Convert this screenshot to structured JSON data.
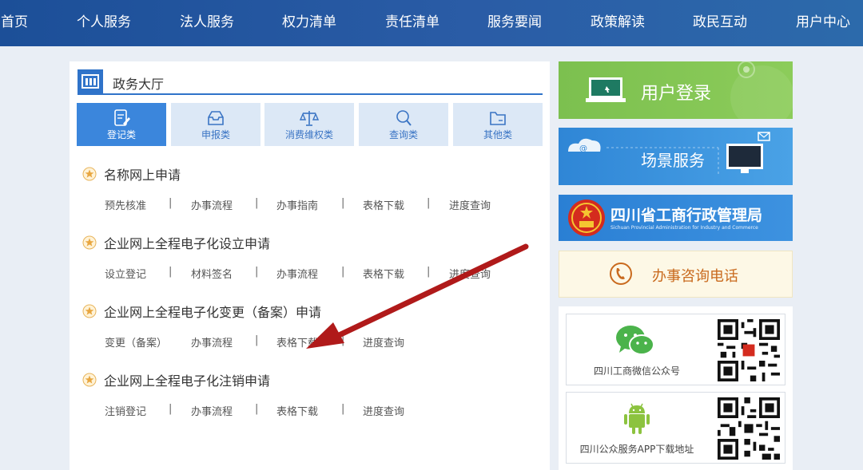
{
  "nav": [
    "首页",
    "个人服务",
    "法人服务",
    "权力清单",
    "责任清单",
    "服务要闻",
    "政策解读",
    "政民互动",
    "用户中心"
  ],
  "hall": {
    "title": "政务大厅",
    "tabs": [
      "登记类",
      "申报类",
      "消费维权类",
      "查询类",
      "其他类"
    ],
    "sections": [
      {
        "title": "名称网上申请",
        "links": [
          "预先核准",
          "办事流程",
          "办事指南",
          "表格下载",
          "进度查询"
        ]
      },
      {
        "title": "企业网上全程电子化设立申请",
        "links": [
          "设立登记",
          "材料签名",
          "办事流程",
          "表格下载",
          "进度查询"
        ]
      },
      {
        "title": "企业网上全程电子化变更（备案）申请",
        "links": [
          "变更（备案）",
          "办事流程",
          "表格下载",
          "进度查询"
        ]
      },
      {
        "title": "企业网上全程电子化注销申请",
        "links": [
          "注销登记",
          "办事流程",
          "表格下载",
          "进度查询"
        ]
      }
    ],
    "separator": "|"
  },
  "side": {
    "login": "用户登录",
    "scene": "场景服务",
    "bureau_cn": "四川省工商行政管理局",
    "bureau_en": "Sichuan Provincial Administration for Industry and Commerce",
    "phone": "办事咨询电话",
    "wechat": "四川工商微信公众号",
    "app": "四川公众服务APP下载地址"
  },
  "colors": {
    "accent": "#3b86dc",
    "nav": "#1c4f98",
    "arrow": "#b01a1a",
    "login": "#7cc04f",
    "phone_text": "#c96a1e"
  }
}
